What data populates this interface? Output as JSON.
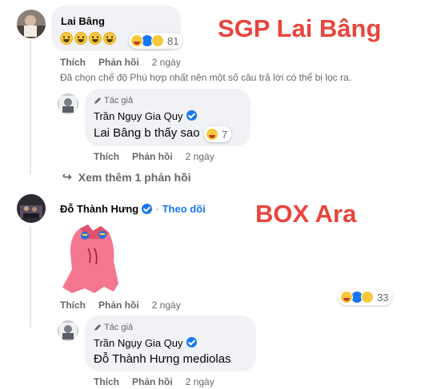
{
  "overlays": {
    "top_label": "SGP Lai Bâng",
    "mid_label": "BOX Ara"
  },
  "comment1": {
    "author": "Lai Bâng",
    "text_emojis": [
      "grinning-face",
      "grinning-face",
      "grinning-face",
      "grinning-face"
    ],
    "reaction_icons": [
      "haha",
      "like",
      "sad"
    ],
    "reaction_count": "81",
    "like_label": "Thích",
    "reply_label": "Phản hồi",
    "time": "2 ngày",
    "filter_notice": "Đã chọn chế độ Phù hợp nhất nên một số câu trả lời có thể bị lọc ra."
  },
  "reply1": {
    "author_badge": "Tác giả",
    "author": "Trần Ngụy Gia Quy",
    "mention": "Lai Bâng",
    "text": " b thấy sao",
    "reaction_icons": [
      "haha"
    ],
    "reaction_count": "7",
    "like_label": "Thích",
    "reply_label": "Phản hồi",
    "time": "2 ngày"
  },
  "more_replies": {
    "label": "Xem thêm 1 phản hồi"
  },
  "comment2": {
    "author": "Đỗ Thành Hưng",
    "separator": "·",
    "follow_label": "Theo dõi",
    "sticker": "pink-ghost-sticker",
    "reaction_icons": [
      "haha",
      "like",
      "sad"
    ],
    "reaction_count": "33",
    "like_label": "Thích",
    "reply_label": "Phản hồi",
    "time": "2 ngày"
  },
  "reply2": {
    "author_badge": "Tác giả",
    "author": "Trần Ngụy Gia Quy",
    "mention": "Đỗ Thành Hưng",
    "text": " mediolas",
    "like_label": "Thích",
    "reply_label": "Phản hồi",
    "time": "2 ngày"
  },
  "colors": {
    "bubble": "#f0f2f5",
    "mention": "#1b74e4",
    "overlay_text": "#e8453c",
    "verified": "#1877f2",
    "muted_text": "#65676b"
  }
}
